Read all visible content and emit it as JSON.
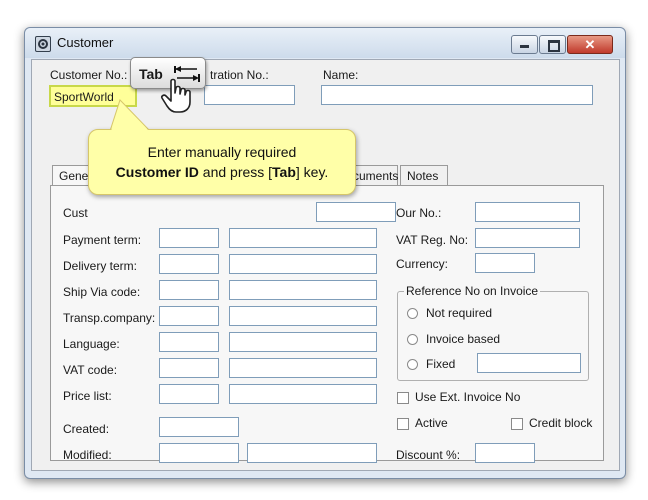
{
  "window": {
    "title": "Customer",
    "app_icon": "gear-icon",
    "controls": [
      "minimize-icon",
      "maximize-icon",
      "close-icon"
    ]
  },
  "header": {
    "customer_no_label": "Customer No.:",
    "customer_no_value": "SportWorld",
    "registration_no_label": "tration No.:",
    "name_label": "Name:"
  },
  "tabs": [
    {
      "label": "Gene"
    },
    {
      "label": "cuments"
    },
    {
      "label": "Notes"
    }
  ],
  "left_fields": [
    {
      "label": "Cust"
    },
    {
      "label": "Payment term:"
    },
    {
      "label": "Delivery term:"
    },
    {
      "label": "Ship Via code:"
    },
    {
      "label": "Transp.company:"
    },
    {
      "label": "Language:"
    },
    {
      "label": "VAT code:"
    },
    {
      "label": "Price list:"
    }
  ],
  "dates": {
    "created_label": "Created:",
    "modified_label": "Modified:"
  },
  "right_fields": {
    "our_no_label": "Our No.:",
    "vat_reg_label": "VAT Reg. No:",
    "currency_label": "Currency:"
  },
  "reference_group": {
    "title": "Reference No on Invoice",
    "options": [
      "Not required",
      "Invoice based",
      "Fixed"
    ]
  },
  "checkboxes": {
    "use_ext_invoice": "Use Ext. Invoice No",
    "active": "Active",
    "credit_block": "Credit block"
  },
  "discount_label": "Discount %:",
  "callout": {
    "line1": "Enter manually required",
    "line2_bold": "Customer ID",
    "line2_rest": " and press [",
    "line2_key": "Tab",
    "line2_end": "] key."
  },
  "keycap": {
    "label": "Tab",
    "icon": "tab-arrow-icon",
    "pointer": "hand-pointer-icon"
  },
  "colors": {
    "highlight": "#ffff99",
    "callout_bg": "#ffffa8",
    "close_button": "#c0392b"
  }
}
